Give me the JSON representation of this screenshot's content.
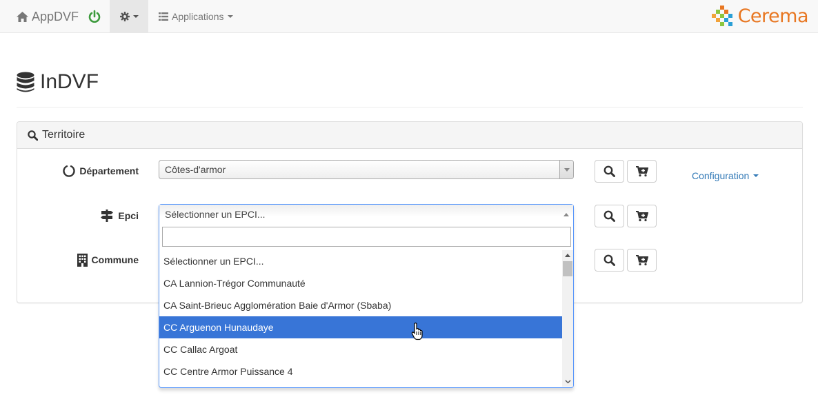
{
  "navbar": {
    "brand_label": "AppDVF",
    "apps_label": "Applications",
    "logo_text": "Cerema",
    "colors": {
      "power": "#3c9a3c",
      "logo": "#e87722",
      "logo_blue": "#2a9fd6"
    }
  },
  "page": {
    "title": "InDVF"
  },
  "panel": {
    "title": "Territoire",
    "departement": {
      "label": "Département",
      "value": "Côtes-d'armor"
    },
    "epci": {
      "label": "Epci",
      "value": "Sélectionner un EPCI..."
    },
    "commune": {
      "label": "Commune"
    },
    "config_label": "Configuration"
  },
  "dropdown": {
    "search_value": "",
    "options": [
      "Sélectionner un EPCI...",
      "CA Lannion-Trégor Communauté",
      "CA Saint-Brieuc Agglomération Baie d'Armor (Sbaba)",
      "CC Arguenon Hunaudaye",
      "CC Callac Argoat",
      "CC Centre Armor Puissance 4"
    ],
    "highlighted": "CC Arguenon Hunaudaye",
    "highlight_color": "#3875d7"
  },
  "icons": [
    "home-icon",
    "power-icon",
    "gear-icon",
    "list-icon",
    "database-icon",
    "search-icon",
    "circle-notch-icon",
    "signpost-icon",
    "building-icon",
    "cart-plus-icon"
  ]
}
